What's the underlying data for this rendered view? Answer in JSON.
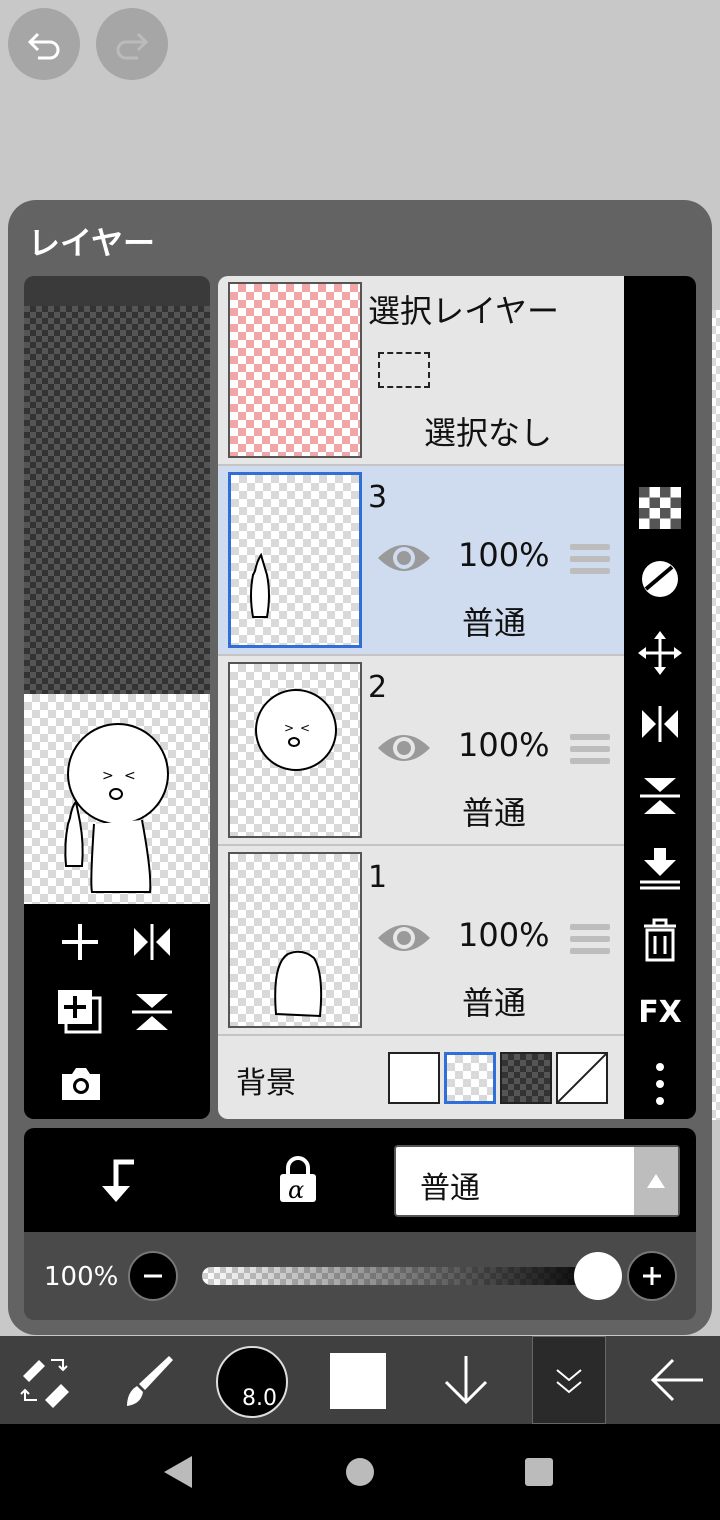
{
  "panel": {
    "title": "レイヤー"
  },
  "selection_layer": {
    "title": "選択レイヤー",
    "status": "選択なし"
  },
  "layers": [
    {
      "number": "3",
      "opacity": "100%",
      "mode": "普通",
      "selected": true
    },
    {
      "number": "2",
      "opacity": "100%",
      "mode": "普通",
      "selected": false
    },
    {
      "number": "1",
      "opacity": "100%",
      "mode": "普通",
      "selected": false
    }
  ],
  "background": {
    "label": "背景",
    "options": [
      "white",
      "transparent",
      "dark-checker",
      "none"
    ],
    "selected": "transparent"
  },
  "properties": {
    "blend_mode": "普通",
    "opacity_label": "100%",
    "opacity_value": 1.0
  },
  "toolbar": {
    "brush_size": "8.0",
    "color": "#ffffff"
  },
  "right_tools": [
    "checker-icon",
    "circle-half-icon",
    "move-icon",
    "flip-horizontal-icon",
    "flip-vertical-icon",
    "merge-down-icon",
    "trash-icon",
    "FX",
    "more-icon"
  ],
  "colors": {
    "selected_row": "#cfdbee",
    "selected_border": "#2f6fd6",
    "panel": "#636363"
  }
}
